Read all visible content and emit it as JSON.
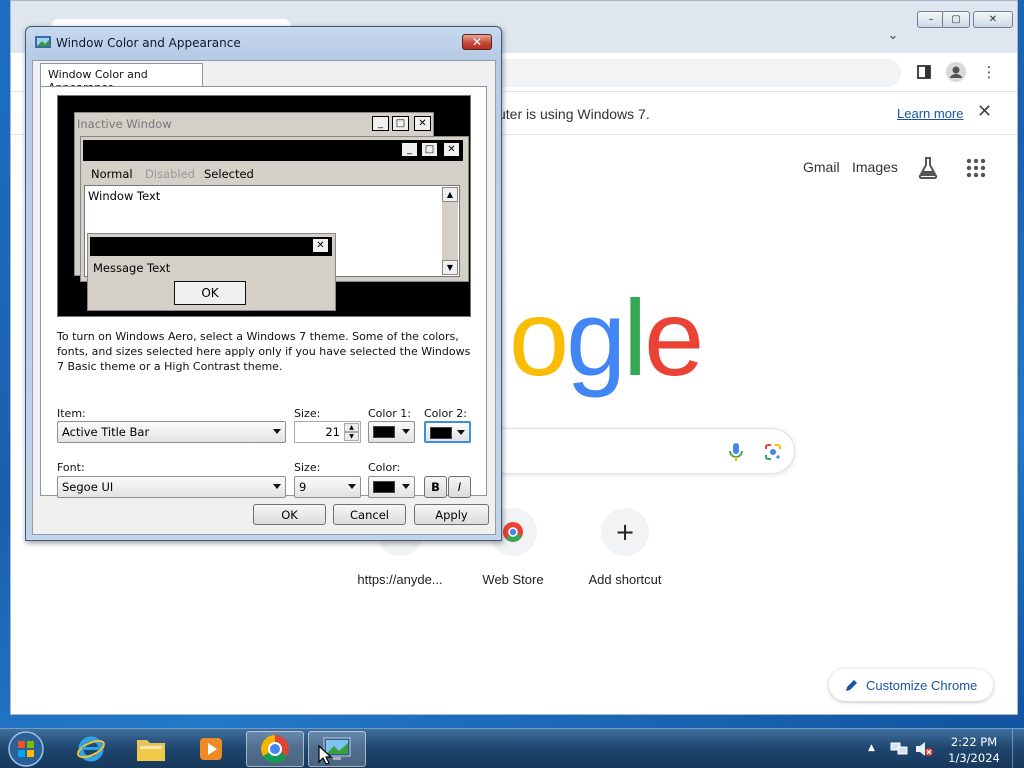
{
  "chrome": {
    "infobar": {
      "message": "uter is using Windows 7.",
      "learn_more": "Learn more"
    },
    "topnav": {
      "gmail": "Gmail",
      "images": "Images"
    },
    "logo_partial": {
      "letters": [
        {
          "char": "o",
          "color": "#fbbc05"
        },
        {
          "char": "g",
          "color": "#4285f4"
        },
        {
          "char": "l",
          "color": "#34a853"
        },
        {
          "char": "e",
          "color": "#ea4335"
        }
      ]
    },
    "shortcuts": [
      {
        "label": "https://anyde..."
      },
      {
        "label": "Web Store"
      },
      {
        "label": "Add shortcut"
      }
    ],
    "customize": "Customize Chrome"
  },
  "dialog": {
    "title": "Window Color and Appearance",
    "tab": "Window Color and Appearance",
    "preview": {
      "inactive_title": "Inactive Window",
      "menu": [
        "Normal",
        "Disabled",
        "Selected"
      ],
      "window_text": "Window Text",
      "message_text": "Message Text",
      "ok": "OK"
    },
    "explanation": "To turn on Windows Aero, select a Windows 7 theme.  Some of the colors, fonts, and sizes selected here apply only if you have selected the Windows 7 Basic theme or a High Contrast theme.",
    "item": {
      "label": "Item:",
      "value": "Active Title Bar",
      "size_label": "Size:",
      "size_value": "21",
      "color1_label": "Color 1:",
      "color2_label": "Color 2:",
      "color1_value": "#000000",
      "color2_value": "#000000"
    },
    "font": {
      "label": "Font:",
      "value": "Segoe UI",
      "size_label": "Size:",
      "size_value": "9",
      "color_label": "Color:",
      "color_value": "#000000",
      "bold": "B",
      "italic": "I"
    },
    "buttons": {
      "ok": "OK",
      "cancel": "Cancel",
      "apply": "Apply"
    }
  },
  "taskbar": {
    "time": "2:22 PM",
    "date": "1/3/2024"
  }
}
